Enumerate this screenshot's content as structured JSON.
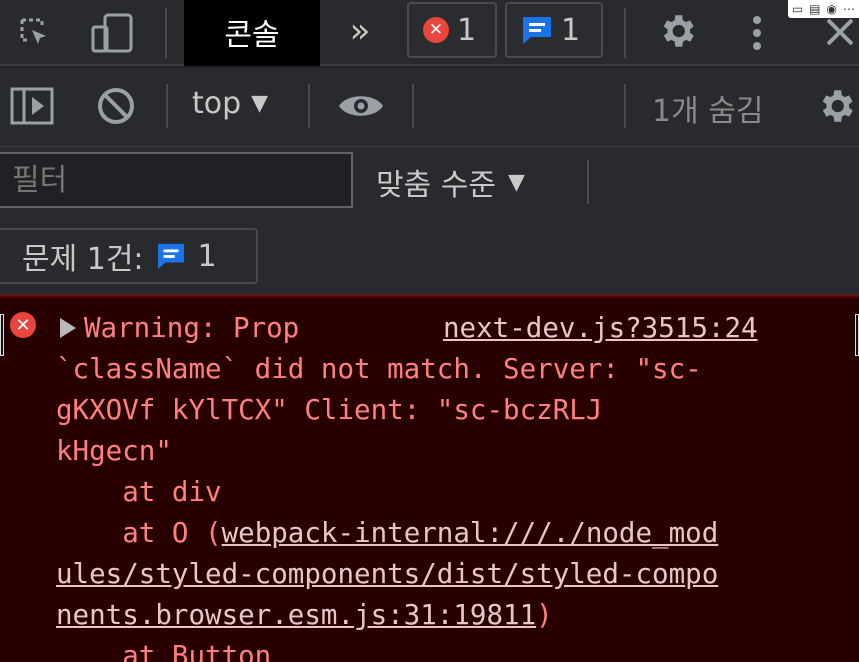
{
  "tabs": {
    "console_label": "콘솔",
    "more_tabs": "»",
    "error_count": "1",
    "message_count": "1"
  },
  "toolbar": {
    "context": "top",
    "hidden_messages": "1개 숨김"
  },
  "filter": {
    "placeholder": "필터",
    "levels_label": "맞춤 수준"
  },
  "issues": {
    "label": "문제 1건:",
    "count": "1"
  },
  "console_error": {
    "source_link": "next-dev.js?3515:24",
    "lines": {
      "l1": "Warning: Prop",
      "l2": "`className` did not match. Server: \"sc-",
      "l3": "gKXOVf kYlTCX\" Client: \"sc-bczRLJ",
      "l4": "kHgecn\"",
      "l5": "    at div",
      "l6_prefix": "    at O (",
      "l6_link": "webpack-internal:///./node_mod",
      "l7_link": "ules/styled-components/dist/styled-compo",
      "l8_link": "nents.browser.esm.js:31:19811",
      "l8_suffix": ")",
      "l9": "    at Button"
    }
  },
  "colors": {
    "panel": "#292a2d",
    "error_bg": "#290000",
    "error_text": "#ff8080",
    "accent_blue": "#1a73e8",
    "error_red": "#e8453c"
  }
}
